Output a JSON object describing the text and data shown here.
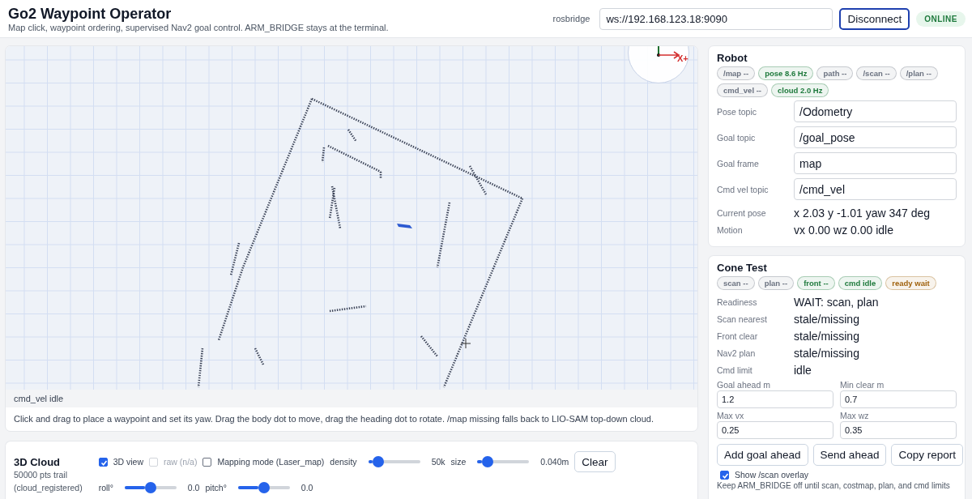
{
  "header": {
    "title": "Go2 Waypoint Operator",
    "subtitle": "Map click, waypoint ordering, supervised Nav2 goal control. ARM_BRIDGE stays at the terminal.",
    "connection_label": "rosbridge",
    "url": "ws://192.168.123.18:9090",
    "connect_button": "Disconnect",
    "status": "ONLINE",
    "online": true
  },
  "map": {
    "axis_label": "X+",
    "status_line": "cmd_vel idle",
    "hint": "Click and drag to place a waypoint and set its yaw. Drag the body dot to move, drag the heading dot to rotate. /map missing falls back to LIO-SAM top-down cloud."
  },
  "cloud": {
    "title": "3D Cloud",
    "info": [
      "50000 pts trail",
      "(cloud_registered)"
    ],
    "checks": [
      {
        "label": "3D view",
        "checked": true,
        "disabled": false
      },
      {
        "label": "raw (n/a)",
        "checked": false,
        "disabled": true
      },
      {
        "label": "Mapping mode (Laser_map)",
        "checked": false,
        "disabled": false
      }
    ],
    "sliders_row1": [
      {
        "label": "density",
        "level": 0.2,
        "reading": "50k"
      },
      {
        "label": "size",
        "level": 0.2,
        "reading": "0.040m"
      }
    ],
    "clear_button": "Clear",
    "sliders_row2": [
      {
        "label": "roll°",
        "level": 0.5,
        "reading": "0.0"
      },
      {
        "label": "pitch°",
        "level": 0.5,
        "reading": "0.0"
      }
    ]
  },
  "robot": {
    "title": "Robot",
    "chips": [
      {
        "label": "/map --",
        "color": "#6b7280"
      },
      {
        "label": "pose 8.6 Hz",
        "color": "#1f7a3d"
      },
      {
        "label": "path --",
        "color": "#6b7280"
      },
      {
        "label": "/scan --",
        "color": "#6b7280"
      },
      {
        "label": "/plan --",
        "color": "#6b7280"
      },
      {
        "label": "cmd_vel --",
        "color": "#6b7280"
      },
      {
        "label": "cloud 2.0 Hz",
        "color": "#1f7a3d"
      }
    ],
    "fields": [
      {
        "label": "Pose topic",
        "value": "/Odometry"
      },
      {
        "label": "Goal topic",
        "value": "/goal_pose"
      },
      {
        "label": "Goal frame",
        "value": "map"
      },
      {
        "label": "Cmd vel topic",
        "value": "/cmd_vel"
      }
    ],
    "readouts": [
      {
        "label": "Current pose",
        "value": "x 2.03 y -1.01 yaw 347 deg"
      },
      {
        "label": "Motion",
        "value": "vx 0.00 wz 0.00 idle"
      }
    ]
  },
  "cone_test": {
    "title": "Cone Test",
    "chips": [
      {
        "label": "scan --",
        "color": "#6b7280"
      },
      {
        "label": "plan --",
        "color": "#6b7280"
      },
      {
        "label": "front --",
        "color": "#1f7a3d"
      },
      {
        "label": "cmd idle",
        "color": "#1f7a3d"
      },
      {
        "label": "ready wait",
        "color": "#a0620e"
      }
    ],
    "readouts": [
      {
        "label": "Readiness",
        "value": "WAIT: scan, plan"
      },
      {
        "label": "Scan nearest",
        "value": "stale/missing"
      },
      {
        "label": "Front clear",
        "value": "stale/missing"
      },
      {
        "label": "Nav2 plan",
        "value": "stale/missing"
      },
      {
        "label": "Cmd limit",
        "value": "idle"
      }
    ],
    "params": [
      {
        "label": "Goal ahead m",
        "value": "1.2"
      },
      {
        "label": "Min clear m",
        "value": "0.7"
      },
      {
        "label": "Max vx",
        "value": "0.25"
      },
      {
        "label": "Max wz",
        "value": "0.35"
      }
    ],
    "buttons": [
      "Add goal ahead",
      "Send ahead",
      "Copy report"
    ],
    "overlay": {
      "label": "Show /scan overlay",
      "checked": true
    },
    "note": "Keep ARM_BRIDGE off until scan, costmap, plan, and cmd limits"
  }
}
